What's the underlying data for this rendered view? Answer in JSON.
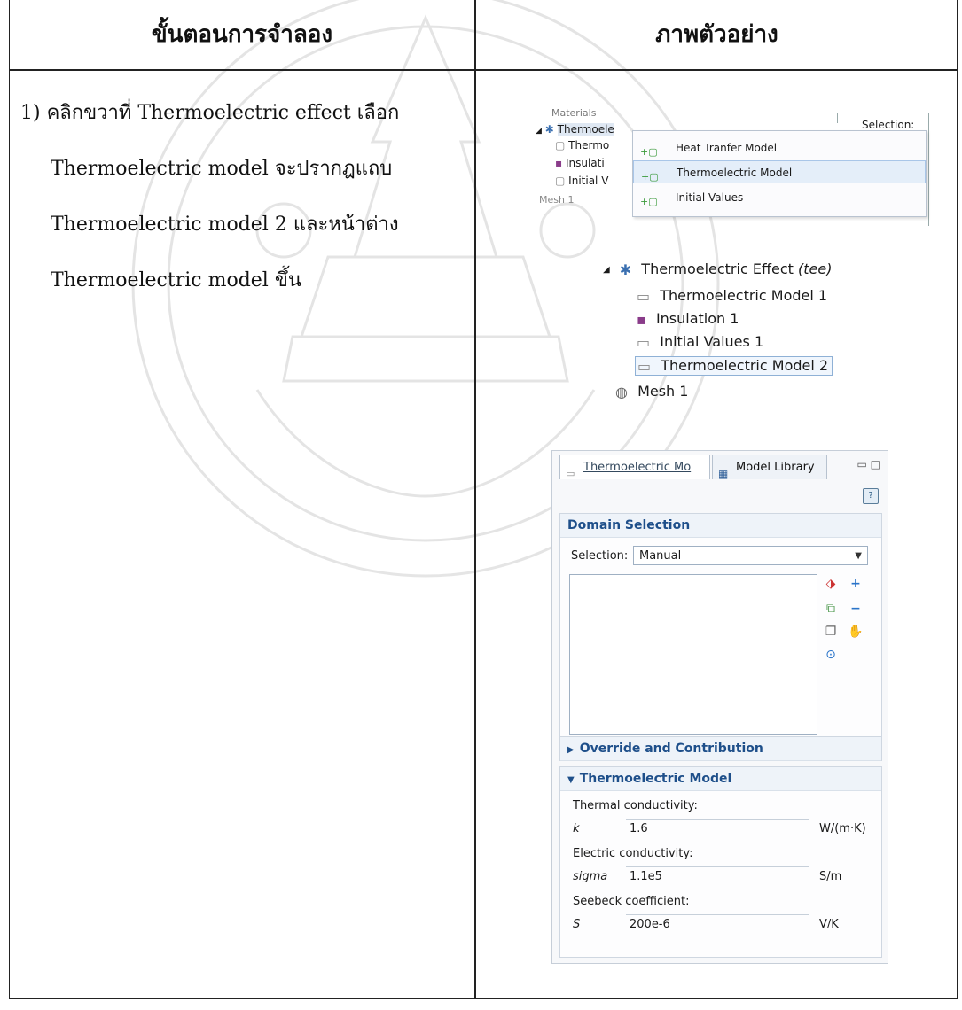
{
  "header": {
    "left": "ขั้นตอนการจำลอง",
    "right": "ภาพตัวอย่าง"
  },
  "step": {
    "line1": "1) คลิกขวาที่ Thermoelectric   effect   เลือก",
    "line2": "Thermoelectric  model   จะปรากฎแถบ",
    "line3": "Thermoelectric   model   2 และหน้าต่าง",
    "line4": "Thermoelectric model ขึ้น"
  },
  "context_shot": {
    "tree": [
      "Materials",
      "Thermoele",
      "Thermo",
      "Insulati",
      "Initial V",
      "Mesh 1"
    ],
    "selection_label": "Selection:",
    "menu_items": [
      "Heat Tranfer Model",
      "Thermoelectric Model",
      "Initial Values"
    ]
  },
  "model_tree": {
    "root": "Thermoelectric Effect",
    "root_tag": "(tee)",
    "children": [
      "Thermoelectric Model 1",
      "Insulation 1",
      "Initial Values 1",
      "Thermoelectric Model 2"
    ],
    "mesh": "Mesh 1"
  },
  "panel": {
    "tab1": "Thermoelectric Mo",
    "tab2": "Model Library",
    "help": "?",
    "domain_section": "Domain Selection",
    "selection_label": "Selection:",
    "selection_value": "Manual",
    "override_section": "Override and Contribution",
    "model_section": "Thermoelectric Model",
    "fields": [
      {
        "label": "Thermal conductivity:",
        "symbol": "k",
        "value": "1.6",
        "unit": "W/(m·K)"
      },
      {
        "label": "Electric conductivity:",
        "symbol": "sigma",
        "value": "1.1e5",
        "unit": "S/m"
      },
      {
        "label": "Seebeck coefficient:",
        "symbol": "S",
        "value": "200e-6",
        "unit": "V/K"
      }
    ]
  },
  "watermark_text": "มหาวิทยาลัยเทคโนโลยีพระจอมเกล้าพระนครเหนือ",
  "colors": {
    "accent": "#1e4f8a",
    "selection_highlight": "#e4eef9",
    "watermark": "#c8c8c8"
  }
}
